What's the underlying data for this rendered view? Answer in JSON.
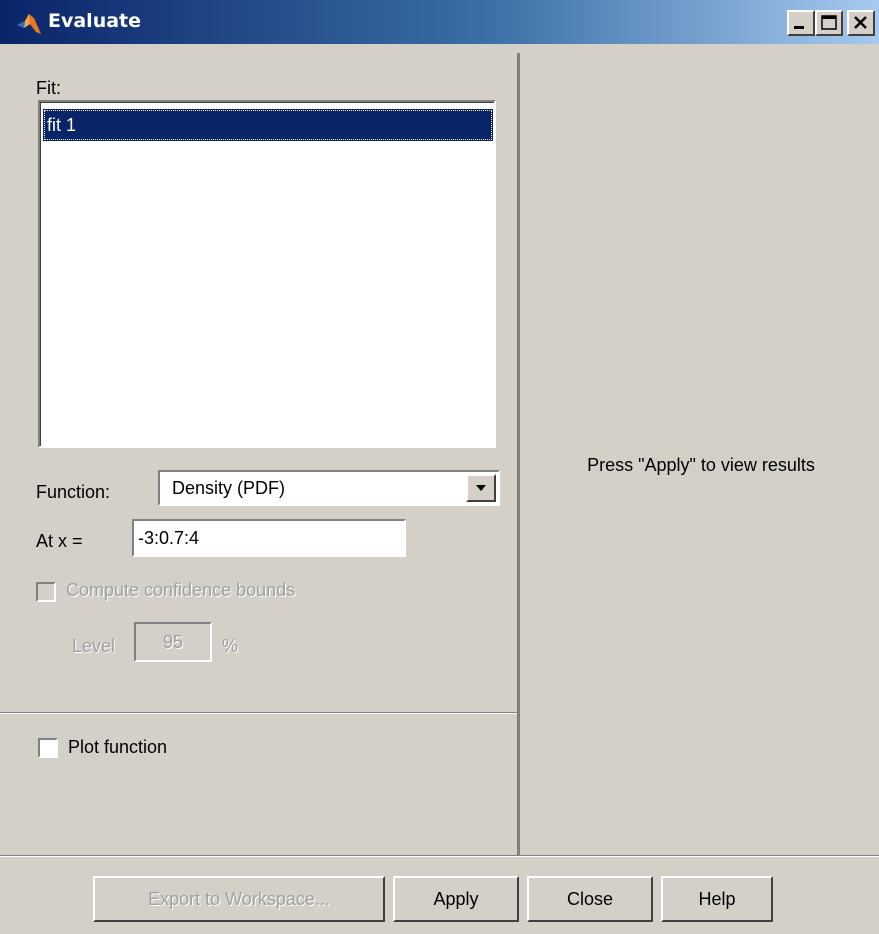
{
  "window": {
    "title": "Evaluate",
    "controls": [
      "minimize-icon",
      "maximize-icon",
      "close-icon"
    ]
  },
  "fit": {
    "label": "Fit:",
    "items": [
      "fit 1"
    ],
    "selected": "fit 1"
  },
  "function": {
    "label": "Function:",
    "value": "Density (PDF)"
  },
  "at_x": {
    "label": "At x =",
    "value": "-3:0.7:4"
  },
  "confidence": {
    "label": "Compute confidence bounds",
    "checked": false,
    "enabled": false,
    "level_label": "Level",
    "level_value": "95",
    "percent_label": "%"
  },
  "plot": {
    "label": "Plot function",
    "checked": false
  },
  "results": {
    "message": "Press \"Apply\" to view results"
  },
  "buttons": {
    "export": "Export to Workspace...",
    "apply": "Apply",
    "close": "Close",
    "help": "Help"
  }
}
